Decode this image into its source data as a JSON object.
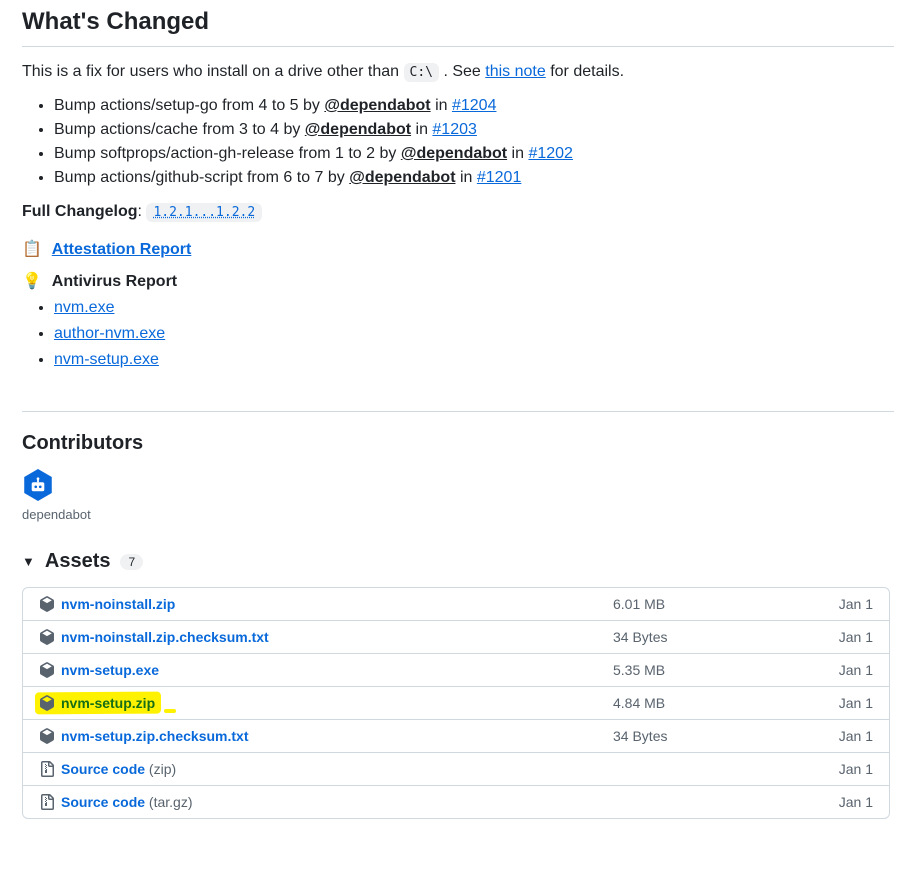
{
  "release": {
    "heading": "What's Changed",
    "intro_prefix": "This is a fix for users who install on a drive other than ",
    "intro_code": "C:\\",
    "intro_mid": ". See ",
    "intro_link": "this note",
    "intro_suffix": " for details.",
    "items": [
      {
        "text": "Bump actions/setup-go from 4 to 5 by ",
        "mention": "@dependabot",
        "mid": " in ",
        "pr": "#1204"
      },
      {
        "text": "Bump actions/cache from 3 to 4 by ",
        "mention": "@dependabot",
        "mid": " in ",
        "pr": "#1203"
      },
      {
        "text": "Bump softprops/action-gh-release from 1 to 2 by ",
        "mention": "@dependabot",
        "mid": " in ",
        "pr": "#1202"
      },
      {
        "text": "Bump actions/github-script from 6 to 7 by ",
        "mention": "@dependabot",
        "mid": " in ",
        "pr": "#1201"
      }
    ],
    "changelog_label": "Full Changelog",
    "changelog_range": "1.2.1...1.2.2",
    "attestation_emoji": "📋",
    "attestation_label": "Attestation Report",
    "antivirus_emoji": "💡",
    "antivirus_label": "Antivirus Report",
    "antivirus_items": [
      {
        "name": "nvm.exe"
      },
      {
        "name": "author-nvm.exe"
      },
      {
        "name": "nvm-setup.exe"
      }
    ]
  },
  "contributors": {
    "heading": "Contributors",
    "name": "dependabot"
  },
  "assets": {
    "heading": "Assets",
    "count": "7",
    "rows": [
      {
        "kind": "pkg",
        "name": "nvm-noinstall.zip",
        "size": "6.01 MB",
        "date": "Jan 1"
      },
      {
        "kind": "pkg",
        "name": "nvm-noinstall.zip.checksum.txt",
        "size": "34 Bytes",
        "date": "Jan 1"
      },
      {
        "kind": "pkg",
        "name": "nvm-setup.exe",
        "size": "5.35 MB",
        "date": "Jan 1"
      },
      {
        "kind": "pkg",
        "name": "nvm-setup.zip",
        "size": "4.84 MB",
        "date": "Jan 1",
        "highlighted": true
      },
      {
        "kind": "pkg",
        "name": "nvm-setup.zip.checksum.txt",
        "size": "34 Bytes",
        "date": "Jan 1"
      },
      {
        "kind": "zip",
        "name": "Source code",
        "variant": "(zip)",
        "size": "",
        "date": "Jan 1"
      },
      {
        "kind": "zip",
        "name": "Source code",
        "variant": "(tar.gz)",
        "size": "",
        "date": "Jan 1"
      }
    ]
  }
}
